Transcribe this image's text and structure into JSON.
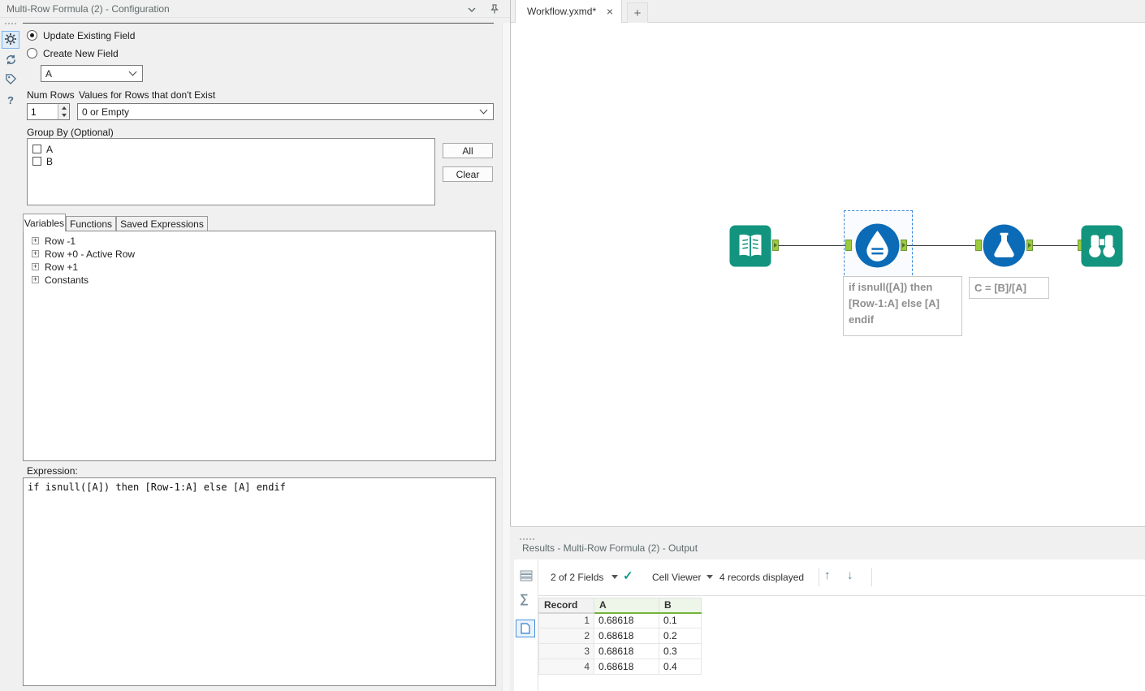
{
  "config": {
    "title": "Multi-Row Formula (2) - Configuration",
    "radio_update_label": "Update Existing Field",
    "radio_create_label": "Create New Field",
    "field_value": "A",
    "num_rows_label": "Num Rows",
    "num_rows_value": "1",
    "values_label": "Values for Rows that don't Exist",
    "values_value": "0 or Empty",
    "group_by_label": "Group By (Optional)",
    "group_items": [
      "A",
      "B"
    ],
    "all_button": "All",
    "clear_button": "Clear",
    "tabs": [
      "Variables",
      "Functions",
      "Saved Expressions"
    ],
    "tree": [
      "Row -1",
      "Row +0 - Active Row",
      "Row +1",
      "Constants"
    ],
    "expression_label": "Expression:",
    "expression": "if isnull([A]) then [Row-1:A] else [A] endif"
  },
  "canvas": {
    "tab_title": "Workflow.yxmd*",
    "tools": [
      {
        "name": "Input Data"
      },
      {
        "name": "Multi-Row Formula",
        "annotation": "if isnull([A]) then [Row-1:A] else [A] endif"
      },
      {
        "name": "Formula",
        "annotation": "C = [B]/[A]"
      },
      {
        "name": "Browse"
      }
    ]
  },
  "results": {
    "title": "Results - Multi-Row Formula (2) - Output",
    "fields_selector": "2 of 2 Fields",
    "cell_viewer_label": "Cell Viewer",
    "records_text": "4 records displayed",
    "columns": [
      "Record",
      "A",
      "B"
    ],
    "rows": [
      [
        "1",
        "0.68618",
        "0.1"
      ],
      [
        "2",
        "0.68618",
        "0.2"
      ],
      [
        "3",
        "0.68618",
        "0.3"
      ],
      [
        "4",
        "0.68618",
        "0.4"
      ]
    ]
  },
  "icons": {
    "check": "✓",
    "arrow_up": "↑",
    "arrow_down": "↓",
    "expander_plus": "+",
    "close": "×",
    "new_tab": "+",
    "question": "?",
    "sigma": "∑"
  },
  "colors": {
    "tool_teal": "#13947f",
    "tool_blue": "#0b6bb7",
    "anchor_green": "#9ccb3b",
    "selection_blue": "#3b87d8"
  }
}
